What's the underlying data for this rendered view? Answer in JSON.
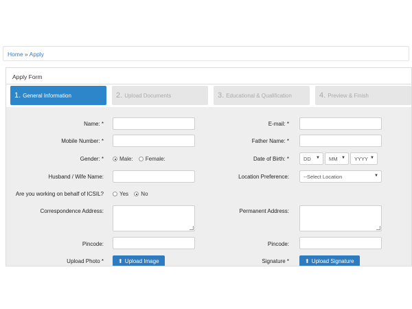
{
  "breadcrumb": {
    "home": "Home",
    "separator": " » ",
    "current": "Apply"
  },
  "panel": {
    "title": "Apply Form"
  },
  "steps": [
    {
      "num": "1.",
      "label": "General Information"
    },
    {
      "num": "2.",
      "label": "Upload Documents"
    },
    {
      "num": "3.",
      "label": "Educational & Qualification"
    },
    {
      "num": "4.",
      "label": "Preview & Finish"
    }
  ],
  "form": {
    "name_label": "Name: *",
    "email_label": "E-mail: *",
    "mobile_label": "Mobile Number: *",
    "father_label": "Father Name: *",
    "gender_label": "Gender: *",
    "gender_male": "Male:",
    "gender_female": "Female:",
    "dob_label": "Date of Birth: *",
    "dob_dd": "DD",
    "dob_mm": "MM",
    "dob_yyyy": "YYYY",
    "husband_label": "Husband / Wife Name:",
    "location_label": "Location Preference:",
    "location_value": "--Select Location",
    "behalf_label": "Are you working on behalf of ICSIL?",
    "behalf_yes": "Yes",
    "behalf_no": "No",
    "corr_label": "Correspondence Address:",
    "perm_label": "Permanent Address:",
    "pincode1_label": "Pincode:",
    "pincode2_label": "Pincode:",
    "photo_label": "Upload Photo *",
    "photo_button": "Upload Image",
    "signature_label": "Signature *",
    "signature_button": "Upload Signature"
  },
  "icons": {
    "upload": "upload-icon",
    "dropdown": "chevron-down-icon"
  },
  "colors": {
    "accent": "#2c86c9",
    "button": "#2f7bbf",
    "form_bg": "#eeeeee"
  }
}
